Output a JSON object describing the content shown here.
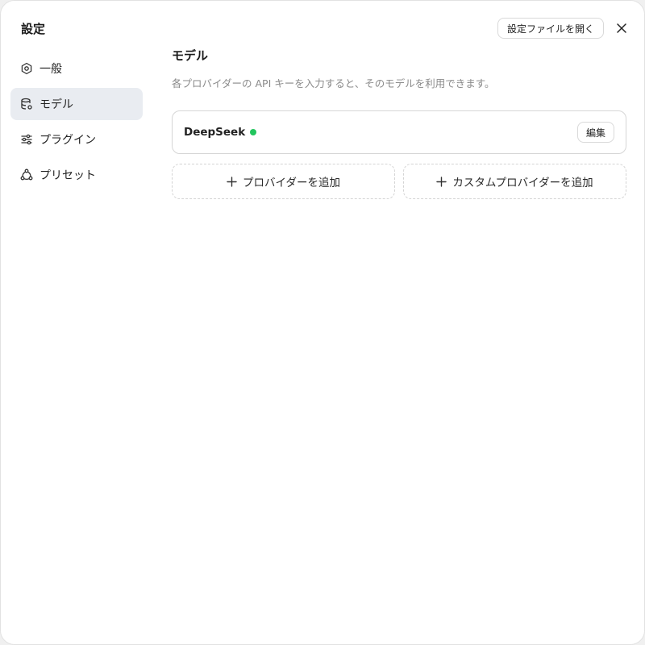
{
  "dialog": {
    "title": "設定"
  },
  "sidebar": {
    "items": [
      {
        "label": "一般",
        "icon": "gear-icon",
        "active": false
      },
      {
        "label": "モデル",
        "icon": "database-gear-icon",
        "active": true
      },
      {
        "label": "プラグイン",
        "icon": "sliders-icon",
        "active": false
      },
      {
        "label": "プリセット",
        "icon": "share-nodes-icon",
        "active": false
      }
    ]
  },
  "header": {
    "open_file_label": "設定ファイルを開く",
    "close_icon": "close-icon"
  },
  "main": {
    "title": "モデル",
    "description": "各プロバイダーの API キーを入力すると、そのモデルを利用できます。",
    "providers": [
      {
        "name": "DeepSeek",
        "status": "active",
        "edit_label": "編集"
      }
    ],
    "add_provider_label": "プロバイダーを追加",
    "add_custom_provider_label": "カスタムプロバイダーを追加"
  },
  "colors": {
    "active_nav_bg": "#e9ecf1",
    "status_active": "#22c55e",
    "muted_text": "#8a8a8a"
  }
}
